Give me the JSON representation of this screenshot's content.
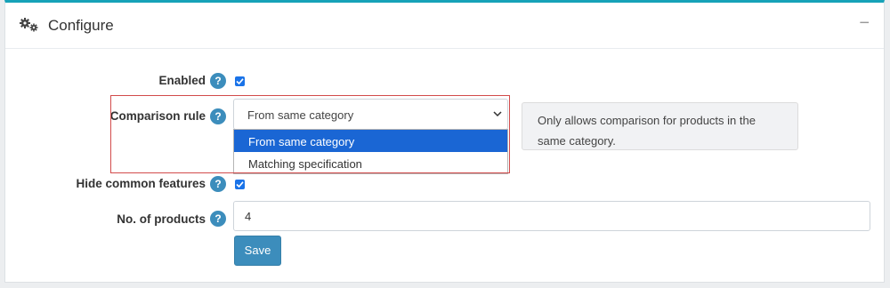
{
  "header": {
    "title": "Configure",
    "collapse_glyph": "−"
  },
  "form": {
    "enabled": {
      "label": "Enabled",
      "checked": true
    },
    "comparison_rule": {
      "label": "Comparison rule",
      "selected": "From same category",
      "options": [
        "From same category",
        "Matching specification"
      ],
      "hint": "Only allows comparison for products in the same category."
    },
    "hide_common_features": {
      "label": "Hide common features",
      "checked": true
    },
    "num_products": {
      "label": "No. of products",
      "value": "4"
    },
    "save_label": "Save",
    "help_glyph": "?"
  },
  "colors": {
    "accent": "#3c8dbc",
    "top_border": "#17a2b8",
    "selection": "#1a66d4",
    "highlight_box": "#d24b4b"
  }
}
